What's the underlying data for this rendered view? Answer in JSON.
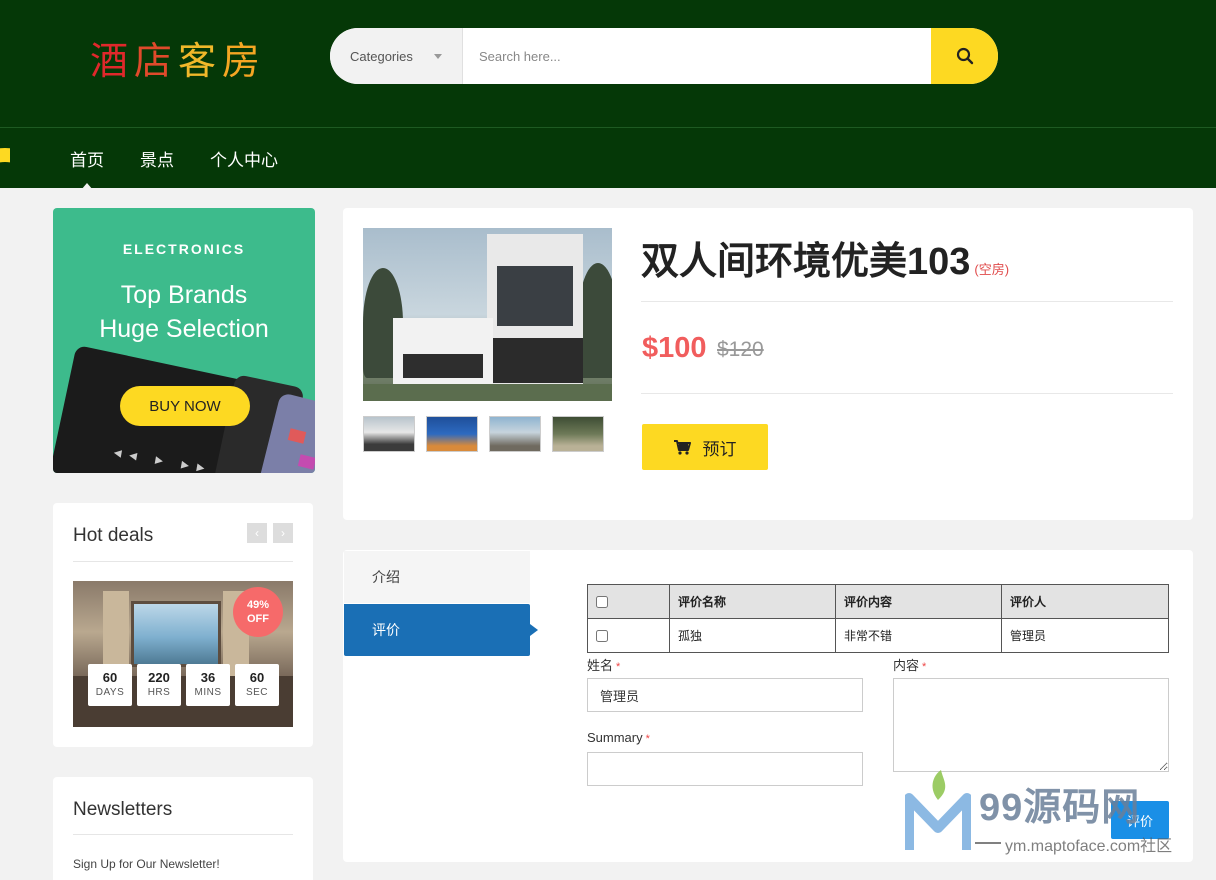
{
  "header": {
    "logo": [
      "酒",
      "店",
      "客",
      "房"
    ],
    "search": {
      "category": "Categories",
      "placeholder": "Search here...",
      "button_icon": "search-icon"
    },
    "nav": [
      "首页",
      "景点",
      "个人中心"
    ]
  },
  "promo": {
    "category": "ELECTRONICS",
    "line1": "Top Brands",
    "line2": "Huge Selection",
    "button": "BUY NOW"
  },
  "hot_deals": {
    "title": "Hot deals",
    "badge_line1": "49%",
    "badge_line2": "OFF",
    "countdown": [
      {
        "value": "60",
        "unit": "DAYS"
      },
      {
        "value": "220",
        "unit": "HRS"
      },
      {
        "value": "36",
        "unit": "MINS"
      },
      {
        "value": "60",
        "unit": "SEC"
      }
    ]
  },
  "newsletter": {
    "title": "Newsletters",
    "subtitle": "Sign Up for Our Newsletter!"
  },
  "product": {
    "name": "双人间环境优美103",
    "status": "(空房)",
    "price": "$100",
    "old_price": "$120",
    "book_label": "预订"
  },
  "tabs": {
    "intro": "介绍",
    "review": "评价"
  },
  "reviews_table": {
    "headers": [
      "评价名称",
      "评价内容",
      "评价人"
    ],
    "rows": [
      [
        "孤独",
        "非常不错",
        "管理员"
      ]
    ]
  },
  "form": {
    "name_label": "姓名",
    "name_value": "管理员",
    "summary_label": "Summary",
    "summary_value": "",
    "content_label": "内容",
    "required_mark": "*",
    "submit": "评价"
  },
  "watermark": {
    "big": "99源码网",
    "small": "ym.maptoface.com社区"
  },
  "colors": {
    "header_bg": "#053807",
    "accent_yellow": "#fdd922",
    "promo_green": "#3dbb8c",
    "price_red": "#f15d5d",
    "tab_blue": "#1a6fb5"
  }
}
